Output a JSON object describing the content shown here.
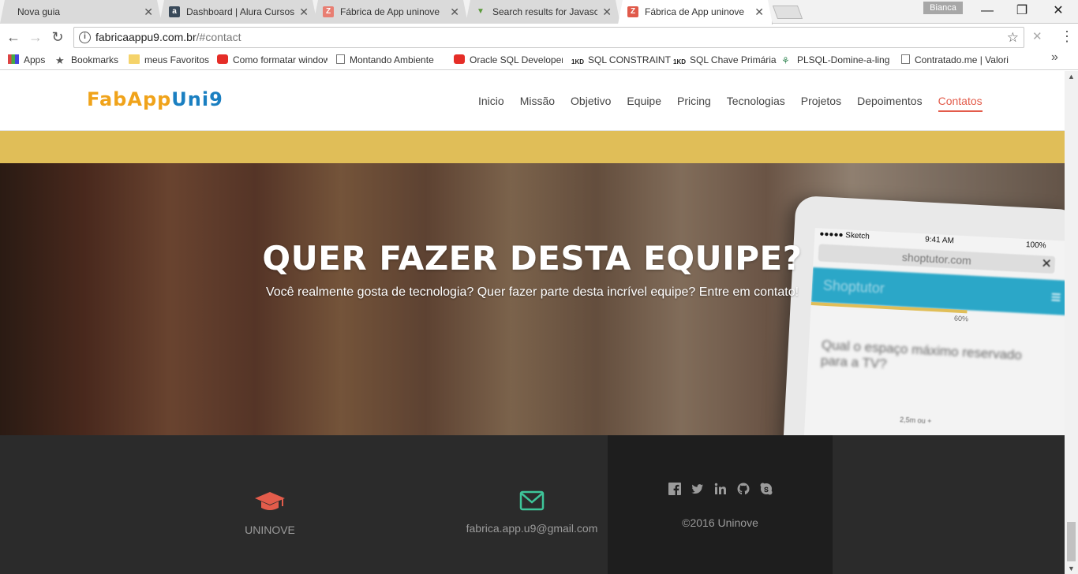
{
  "browser": {
    "tabs": [
      {
        "title": "Nova guia",
        "favicon": "none",
        "active": false
      },
      {
        "title": "Dashboard | Alura Cursos",
        "favicon": "alura-icon",
        "active": false
      },
      {
        "title": "Fábrica de App uninove",
        "favicon": "zoho-icon",
        "active": false
      },
      {
        "title": "Search results for Javascript",
        "favicon": "filter-icon",
        "active": false
      },
      {
        "title": "Fábrica de App uninove",
        "favicon": "zoho-icon",
        "active": true
      }
    ],
    "profile_name": "Bianca",
    "url_host": "fabricaappu9.com.br",
    "url_path": "/#contact",
    "bookmarks": [
      {
        "label": "Apps",
        "icon": "apps-grid-icon"
      },
      {
        "label": "Bookmarks",
        "icon": "star-icon"
      },
      {
        "label": "meus Favoritos",
        "icon": "folder-icon"
      },
      {
        "label": "Como formatar windows",
        "icon": "youtube-icon"
      },
      {
        "label": "Montando Ambiente",
        "icon": "page-icon"
      },
      {
        "label": "Oracle SQL Developer",
        "icon": "youtube-icon"
      },
      {
        "label": "SQL CONSTRAINT",
        "icon": "1kd-icon"
      },
      {
        "label": "SQL Chave Primária",
        "icon": "1kd-icon"
      },
      {
        "label": "PLSQL-Domine-a-linguagem",
        "icon": "network-icon"
      },
      {
        "label": "Contratado.me | Valorizamos",
        "icon": "page-icon"
      }
    ]
  },
  "site": {
    "logo_part1": "FabApp",
    "logo_part2": "Uni9",
    "nav": [
      {
        "label": "Inicio",
        "active": false
      },
      {
        "label": "Missão",
        "active": false
      },
      {
        "label": "Objetivo",
        "active": false
      },
      {
        "label": "Equipe",
        "active": false
      },
      {
        "label": "Pricing",
        "active": false
      },
      {
        "label": "Tecnologias",
        "active": false
      },
      {
        "label": "Projetos",
        "active": false
      },
      {
        "label": "Depoimentos",
        "active": false
      },
      {
        "label": "Contatos",
        "active": true
      }
    ],
    "accent_color": "#e35c4b",
    "band_color": "#e0be58"
  },
  "hero": {
    "title": "QUER FAZER DESTA EQUIPE?",
    "subtitle": "Você realmente gosta de tecnologia? Quer fazer parte desta incrível equipe? Entre em contato!",
    "phone": {
      "carrier": "●●●●● Sketch",
      "time": "9:41 AM",
      "battery": "100%",
      "address": "shoptutor.com",
      "app_name": "Shoptutor",
      "progress_label": "60%",
      "progress": 0.6,
      "question": "Qual o espaço máximo reservado para a TV?",
      "dimension_label": "2,5m ou +"
    }
  },
  "footer": {
    "org_icon": "graduation-cap-icon",
    "org_name": "UNINOVE",
    "email_icon": "envelope-icon",
    "email": "fabrica.app.u9@gmail.com",
    "social": [
      "facebook-icon",
      "twitter-icon",
      "linkedin-icon",
      "github-icon",
      "skype-icon"
    ],
    "copyright": "©2016 Uninove",
    "icon_red": "#e35c4b",
    "icon_green": "#3ec59a"
  }
}
